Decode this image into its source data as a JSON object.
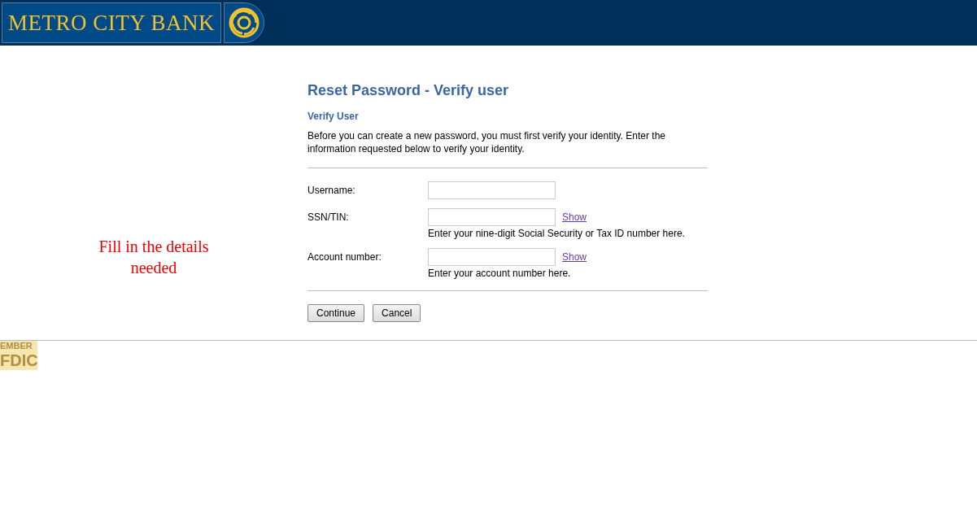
{
  "header": {
    "bank_name": "METRO CITY BANK"
  },
  "note": "Fill in the details needed",
  "page": {
    "title": "Reset Password - Verify user",
    "subtitle": "Verify User",
    "intro": "Before you can create a new password, you must first verify your identity. Enter the information requested below to verify your identity."
  },
  "fields": [
    {
      "label": "Username:"
    },
    {
      "label": "SSN/TIN:",
      "show_link": "Show",
      "hint": "Enter your nine-digit Social Security or Tax ID number here."
    },
    {
      "label": "Account number:",
      "show_link": "Show",
      "hint": "Enter your account number here."
    }
  ],
  "buttons": [
    "Continue",
    "Cancel"
  ],
  "footer": {
    "badge_top": "EMBER",
    "badge_bottom": "FDIC"
  }
}
